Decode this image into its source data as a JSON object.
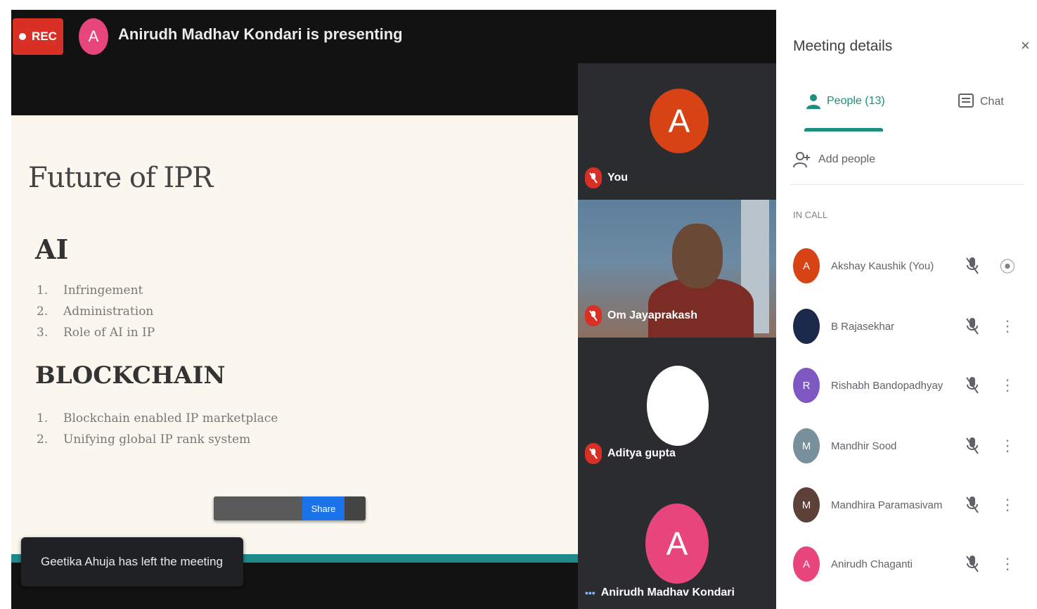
{
  "header": {
    "rec_label": "REC",
    "presenter_initial": "A",
    "presenter_text": "Anirudh Madhav Kondari is presenting"
  },
  "slide": {
    "title": "Future of IPR",
    "section1_heading": "AI",
    "section1_items": [
      {
        "num": "1.",
        "text": "Infringement"
      },
      {
        "num": "2.",
        "text": "Administration"
      },
      {
        "num": "3.",
        "text": "Role of AI in IP"
      }
    ],
    "section2_heading": "BLOCKCHAIN",
    "section2_items": [
      {
        "num": "1.",
        "text": "Blockchain enabled IP marketplace"
      },
      {
        "num": "2.",
        "text": "Unifying global IP rank system"
      }
    ],
    "toolbar_button": "Share"
  },
  "toast": {
    "text": "Geetika Ahuja has left the meeting"
  },
  "tiles": [
    {
      "initial": "A",
      "name": "You",
      "color": "#d84315"
    },
    {
      "initial": "",
      "name": "Om Jayaprakash",
      "color": ""
    },
    {
      "initial": "",
      "name": "Aditya gupta",
      "color": "#ffffff"
    },
    {
      "initial": "A",
      "name": "Anirudh Madhav Kondari",
      "color": "#e8457d"
    }
  ],
  "panel": {
    "title": "Meeting details",
    "close_icon": "×",
    "tab_people": "People (13)",
    "tab_chat": "Chat",
    "add_people": "Add people",
    "section_label": "IN CALL",
    "participants": [
      {
        "initial": "A",
        "name": "Akshay Kaushik (You)",
        "color": "#d84315"
      },
      {
        "initial": "",
        "name": "B Rajasekhar",
        "color": "#1b2a4a"
      },
      {
        "initial": "R",
        "name": "Rishabh Bandopadhyay",
        "color": "#7e57c2"
      },
      {
        "initial": "M",
        "name": "Mandhir Sood",
        "color": "#78909c"
      },
      {
        "initial": "M",
        "name": "Mandhira Paramasivam",
        "color": "#5d4037"
      },
      {
        "initial": "A",
        "name": "Anirudh Chaganti",
        "color": "#e8457d"
      }
    ]
  }
}
